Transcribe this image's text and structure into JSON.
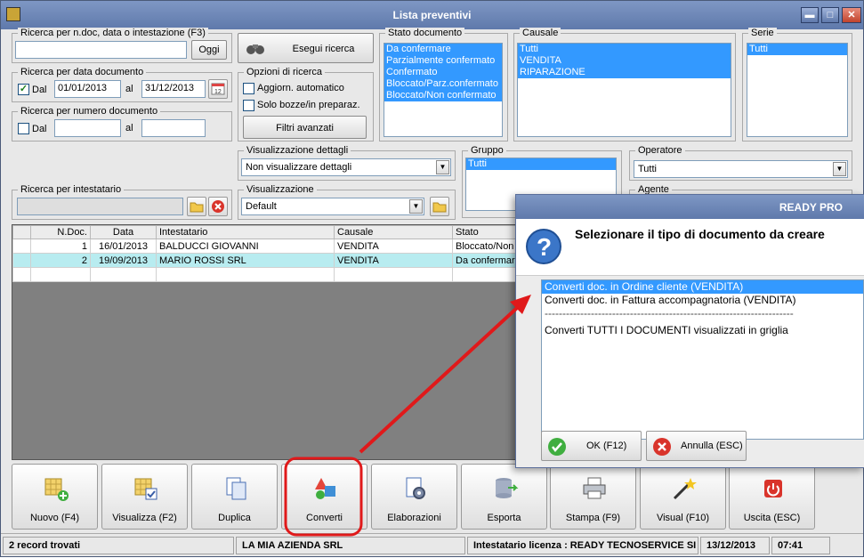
{
  "window": {
    "title": "Lista preventivi"
  },
  "search_text": {
    "label": "Ricerca per n.doc, data o intestazione (F3)",
    "value": "",
    "today_button": "Oggi"
  },
  "search_button": "Esegui ricerca",
  "date_search": {
    "label": "Ricerca per data documento",
    "from_label": "Dal",
    "from_value": "01/01/2013",
    "to_label": "al",
    "to_value": "31/12/2013",
    "checked": true
  },
  "number_search": {
    "label": "Ricerca per numero documento",
    "from_label": "Dal",
    "to_label": "al",
    "from_value": "",
    "to_value": ""
  },
  "options": {
    "label": "Opzioni di ricerca",
    "auto_update": "Aggiorn. automatico",
    "drafts_only": "Solo bozze/in preparaz.",
    "advanced_filters": "Filtri avanzati"
  },
  "stato_documento": {
    "label": "Stato documento",
    "items": [
      "Da confermare",
      "Parzialmente confermato",
      "Confermato",
      "Bloccato/Parz.confermato",
      "Bloccato/Non confermato"
    ]
  },
  "causale": {
    "label": "Causale",
    "items": [
      "Tutti",
      "VENDITA",
      "RIPARAZIONE"
    ]
  },
  "serie": {
    "label": "Serie",
    "items": [
      "Tutti"
    ]
  },
  "dettagli": {
    "label": "Visualizzazione dettagli",
    "value": "Non visualizzare dettagli"
  },
  "gruppo": {
    "label": "Gruppo",
    "items": [
      "Tutti"
    ]
  },
  "operatore": {
    "label": "Operatore",
    "value": "Tutti"
  },
  "agente": {
    "label": "Agente"
  },
  "intestatario": {
    "label": "Ricerca per intestatario",
    "value": ""
  },
  "visualizzazione": {
    "label": "Visualizzazione",
    "value": "Default"
  },
  "grid": {
    "columns": [
      "N.Doc.",
      "Data",
      "Intestatario",
      "Causale",
      "Stato"
    ],
    "rows": [
      [
        "1",
        "16/01/2013",
        "BALDUCCI GIOVANNI",
        "VENDITA",
        "Bloccato/Non c"
      ],
      [
        "2",
        "19/09/2013",
        "MARIO ROSSI SRL",
        "VENDITA",
        "Da confermare"
      ]
    ]
  },
  "toolbar": [
    "Nuovo (F4)",
    "Visualizza (F2)",
    "Duplica",
    "Converti",
    "Elaborazioni",
    "Esporta",
    "Stampa (F9)",
    "Visual (F10)",
    "Uscita (ESC)"
  ],
  "status": {
    "records": "2 record trovati",
    "company": "LA MIA AZIENDA SRL",
    "license": "Intestatario licenza : READY TECNOSERVICE SI",
    "date": "13/12/2013",
    "time": "07:41"
  },
  "dialog": {
    "title": "READY PRO",
    "question": "Selezionare il tipo di documento da creare",
    "options": [
      "Converti doc. in Ordine cliente (VENDITA)",
      "Converti doc. in Fattura accompagnatoria (VENDITA)",
      "----------------------------------------------------------------------",
      "Converti TUTTI I DOCUMENTI visualizzati in griglia"
    ],
    "ok": "OK (F12)",
    "cancel": "Annulla (ESC)"
  },
  "colors": {
    "titlebar": "#6b84b5",
    "selection": "#3399ff",
    "highlight": "#e0191a",
    "row_alt": "#b8ecf0"
  },
  "icons": [
    "binoculars-icon",
    "calendar-icon",
    "folder-icon",
    "clear-icon",
    "question-icon",
    "check-icon",
    "cancel-icon"
  ]
}
